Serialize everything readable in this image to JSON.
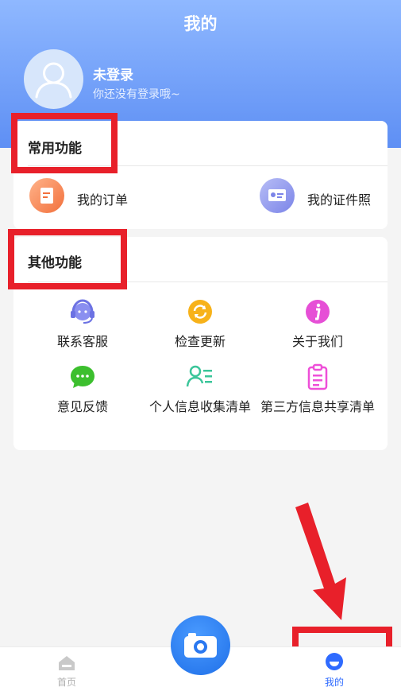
{
  "header": {
    "title": "我的",
    "login_title": "未登录",
    "login_subtitle": "你还没有登录哦~"
  },
  "common": {
    "title": "常用功能",
    "items": [
      {
        "label": "我的订单",
        "icon": "order-icon"
      },
      {
        "label": "我的证件照",
        "icon": "id-photo-icon"
      }
    ]
  },
  "other": {
    "title": "其他功能",
    "items": [
      {
        "label": "联系客服",
        "icon": "headset-icon"
      },
      {
        "label": "检查更新",
        "icon": "refresh-icon"
      },
      {
        "label": "关于我们",
        "icon": "info-icon"
      },
      {
        "label": "意见反馈",
        "icon": "chat-bubble-icon"
      },
      {
        "label": "个人信息收集清单",
        "icon": "user-list-icon"
      },
      {
        "label": "第三方信息共享清单",
        "icon": "clipboard-icon"
      }
    ]
  },
  "tabbar": {
    "home_label": "首页",
    "mine_label": "我的"
  },
  "colors": {
    "header_top": "#8fb8ff",
    "header_bottom": "#5e8ff4",
    "annotation_red": "#e8202a",
    "tab_active": "#2f6bff"
  }
}
